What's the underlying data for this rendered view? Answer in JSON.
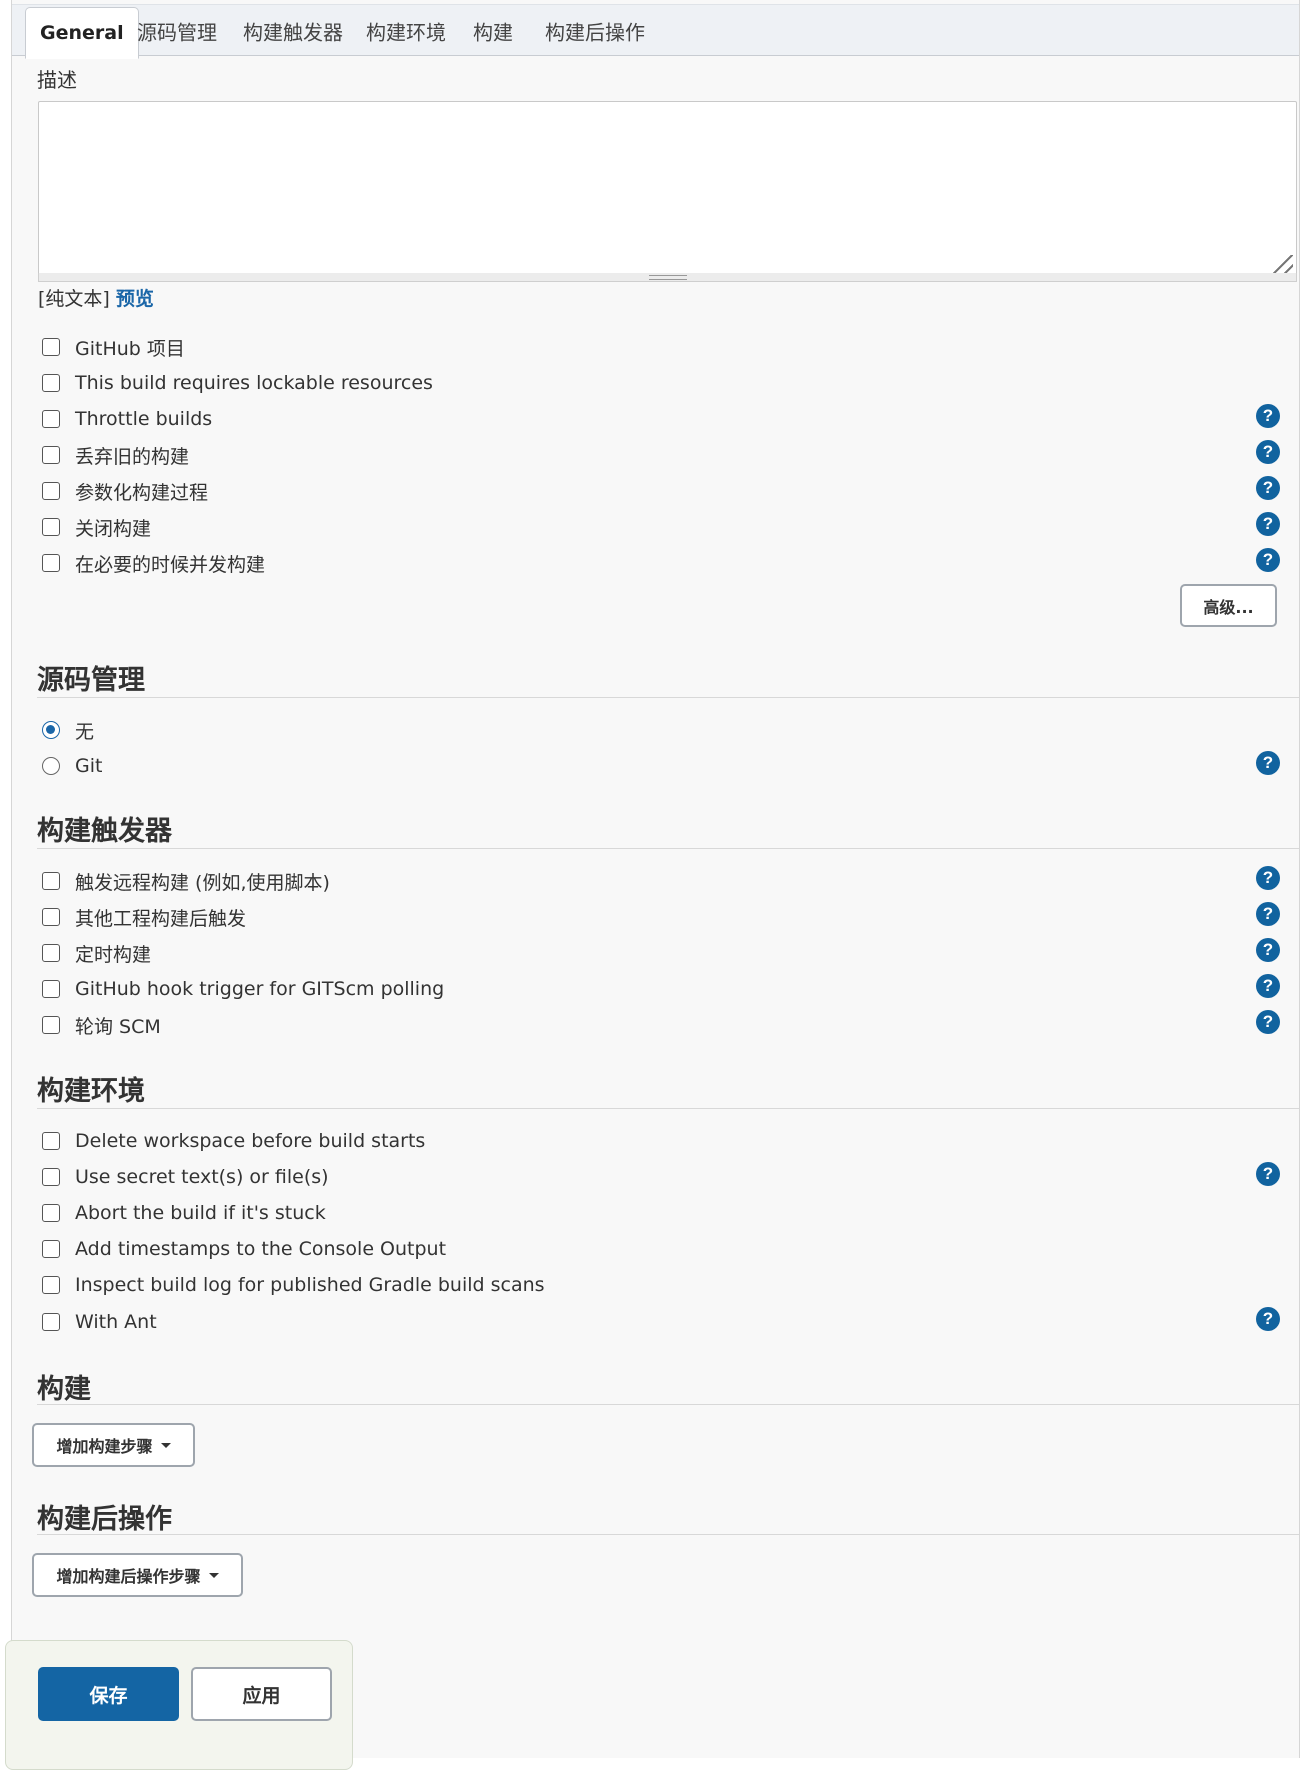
{
  "tabs": [
    "General",
    "源码管理",
    "构建触发器",
    "构建环境",
    "构建",
    "构建后操作"
  ],
  "description": {
    "label": "描述",
    "value": "",
    "format_label": "[纯文本]",
    "preview_link": "预览"
  },
  "general": {
    "options": [
      {
        "label": "GitHub 项目",
        "checked": false,
        "help": false
      },
      {
        "label": "This build requires lockable resources",
        "checked": false,
        "help": false
      },
      {
        "label": "Throttle builds",
        "checked": false,
        "help": true
      },
      {
        "label": "丢弃旧的构建",
        "checked": false,
        "help": true
      },
      {
        "label": "参数化构建过程",
        "checked": false,
        "help": true
      },
      {
        "label": "关闭构建",
        "checked": false,
        "help": true
      },
      {
        "label": "在必要的时候并发构建",
        "checked": false,
        "help": true
      }
    ],
    "advanced_button": "高级..."
  },
  "scm": {
    "title": "源码管理",
    "options": [
      {
        "label": "无",
        "selected": true,
        "help": false
      },
      {
        "label": "Git",
        "selected": false,
        "help": true
      }
    ]
  },
  "triggers": {
    "title": "构建触发器",
    "options": [
      {
        "label": "触发远程构建 (例如,使用脚本)",
        "checked": false,
        "help": true
      },
      {
        "label": "其他工程构建后触发",
        "checked": false,
        "help": true
      },
      {
        "label": "定时构建",
        "checked": false,
        "help": true
      },
      {
        "label": "GitHub hook trigger for GITScm polling",
        "checked": false,
        "help": true
      },
      {
        "label": "轮询 SCM",
        "checked": false,
        "help": true
      }
    ]
  },
  "environment": {
    "title": "构建环境",
    "options": [
      {
        "label": "Delete workspace before build starts",
        "checked": false,
        "help": false
      },
      {
        "label": "Use secret text(s) or file(s)",
        "checked": false,
        "help": true
      },
      {
        "label": "Abort the build if it's stuck",
        "checked": false,
        "help": false
      },
      {
        "label": "Add timestamps to the Console Output",
        "checked": false,
        "help": false
      },
      {
        "label": "Inspect build log for published Gradle build scans",
        "checked": false,
        "help": false
      },
      {
        "label": "With Ant",
        "checked": false,
        "help": true
      }
    ]
  },
  "build": {
    "title": "构建",
    "add_step_button": "增加构建步骤"
  },
  "post_build": {
    "title": "构建后操作",
    "add_step_button": "增加构建后操作步骤"
  },
  "footer": {
    "save_button": "保存",
    "apply_button": "应用"
  },
  "colors": {
    "accent": "#1465a4",
    "help_icon": "#11639f",
    "link": "#1a66a8"
  },
  "help_icon_glyph": "?"
}
